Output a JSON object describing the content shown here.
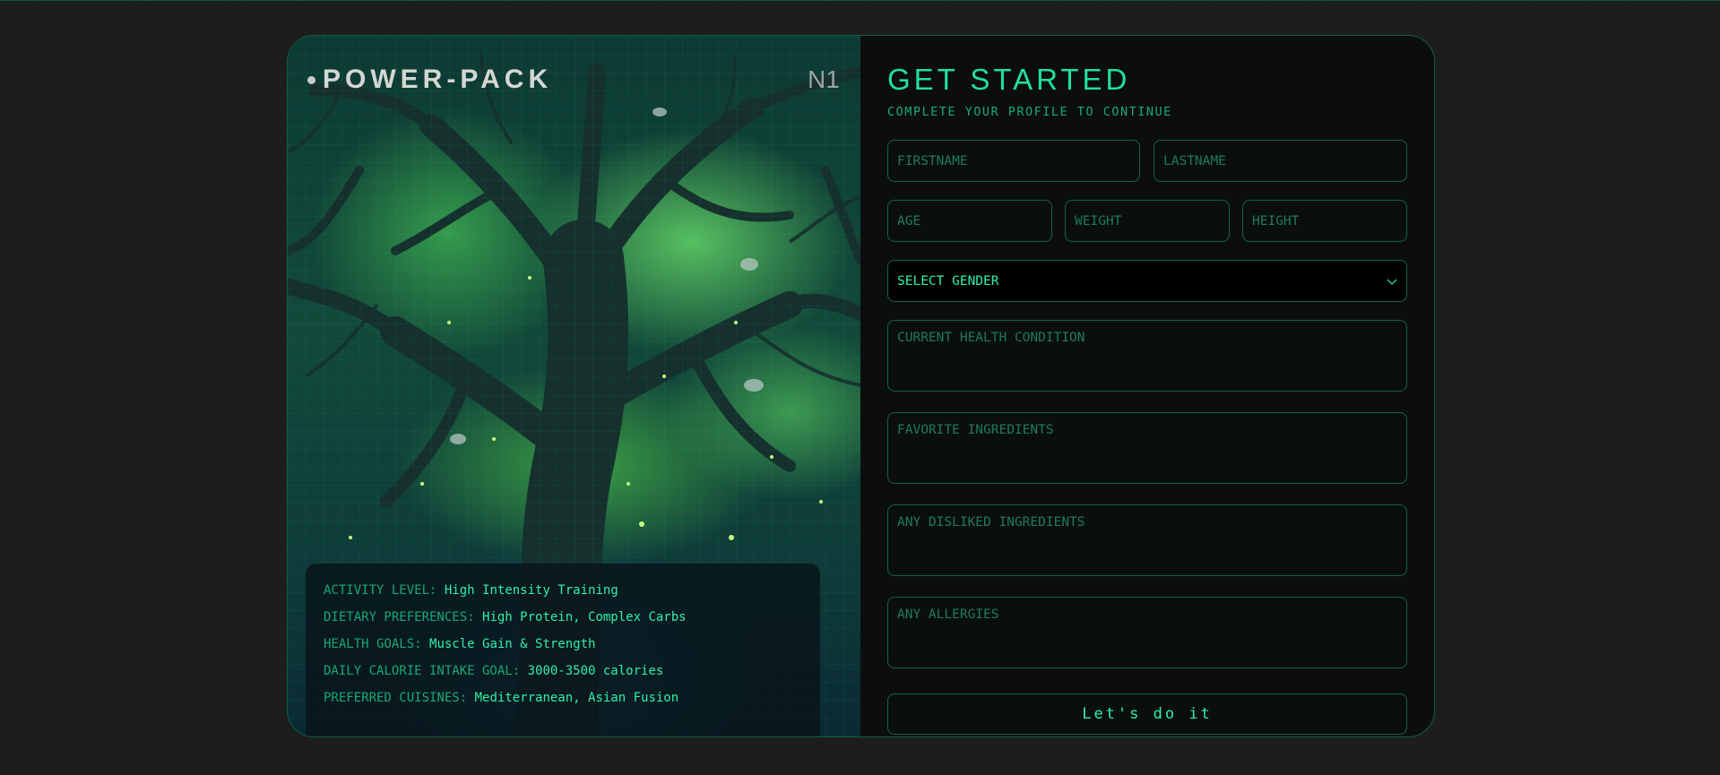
{
  "brand": {
    "name": "POWER-PACK",
    "number": "N1"
  },
  "profile_summary": [
    {
      "label": "ACTIVITY LEVEL:",
      "value": "High Intensity Training"
    },
    {
      "label": "DIETARY PREFERENCES:",
      "value": "High Protein, Complex Carbs"
    },
    {
      "label": "HEALTH GOALS:",
      "value": "Muscle Gain & Strength"
    },
    {
      "label": "DAILY CALORIE INTAKE GOAL:",
      "value": "3000-3500 calories"
    },
    {
      "label": "PREFERRED CUISINES:",
      "value": "Mediterranean, Asian Fusion"
    }
  ],
  "form": {
    "title": "GET STARTED",
    "subtitle": "COMPLETE YOUR PROFILE TO CONTINUE",
    "firstname_placeholder": "FIRSTNAME",
    "lastname_placeholder": "LASTNAME",
    "age_placeholder": "AGE",
    "weight_placeholder": "WEIGHT",
    "height_placeholder": "HEIGHT",
    "gender_select": "SELECT GENDER",
    "health_condition_placeholder": "CURRENT HEALTH CONDITION",
    "favorite_ingredients_placeholder": "FAVORITE INGREDIENTS",
    "disliked_ingredients_placeholder": "ANY DISLIKED INGREDIENTS",
    "allergies_placeholder": "ANY ALLERGIES",
    "submit_label": "Let's do it"
  },
  "colors": {
    "accent": "#22e09a",
    "label": "#18a874",
    "border": "#136346",
    "background": "#1c1c1c"
  }
}
